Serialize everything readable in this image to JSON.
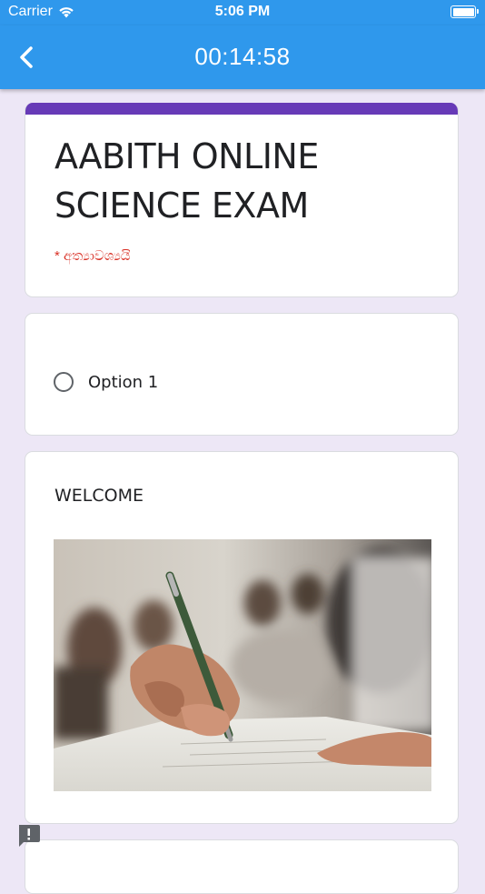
{
  "status_bar": {
    "carrier": "Carrier",
    "time": "5:06 PM"
  },
  "nav": {
    "timer": "00:14:58",
    "back_icon": "chevron-left-icon"
  },
  "form": {
    "title": "AABITH ONLINE SCIENCE EXAM",
    "required_note": "* අත්‍යාවශ්‍යයි"
  },
  "question_option": {
    "label": "Option 1"
  },
  "welcome": {
    "heading": "WELCOME",
    "image": "student-writing-exam-photo"
  },
  "colors": {
    "app_bar": "#2f98ec",
    "accent": "#673ab7",
    "background": "#ede7f6",
    "required": "#d93025"
  }
}
